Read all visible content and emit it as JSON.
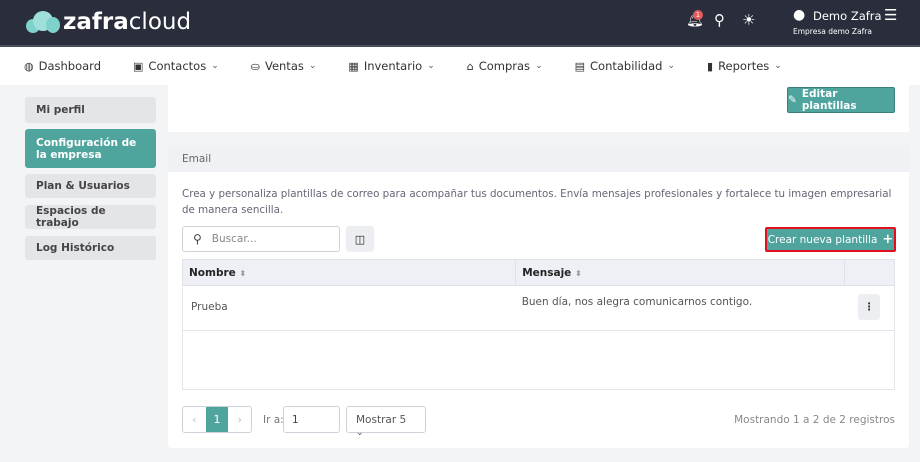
{
  "header": {
    "logo_bold": "zafra",
    "logo_light": "cloud",
    "notification_count": "1",
    "user_name": "Demo Zafra",
    "company": "Empresa demo Zafra"
  },
  "nav": [
    {
      "label": "Dashboard",
      "icon": "dashboard-icon",
      "glyph": "◍"
    },
    {
      "label": "Contactos",
      "icon": "contacts-icon",
      "glyph": "▣"
    },
    {
      "label": "Ventas",
      "icon": "sales-icon",
      "glyph": "⛀"
    },
    {
      "label": "Inventario",
      "icon": "inventory-icon",
      "glyph": "▦"
    },
    {
      "label": "Compras",
      "icon": "store-icon",
      "glyph": "⌂"
    },
    {
      "label": "Contabilidad",
      "icon": "calculator-icon",
      "glyph": "▤"
    },
    {
      "label": "Reportes",
      "icon": "chart-icon",
      "glyph": "▮"
    }
  ],
  "sidebar": [
    {
      "label": "Mi perfil"
    },
    {
      "label": "Configuración de la empresa"
    },
    {
      "label": "Plan & Usuarios"
    },
    {
      "label": "Espacios de trabajo"
    },
    {
      "label": "Log Histórico"
    }
  ],
  "main": {
    "edit_templates": "Editar plantillas",
    "section_title": "Email",
    "description": "Crea y personaliza plantillas de correo para acompañar tus documentos. Envía mensajes profesionales y fortalece tu imagen empresarial de manera sencilla.",
    "search_placeholder": "Buscar...",
    "create_button": "Crear nueva plantilla",
    "columns": [
      "Nombre",
      "Mensaje",
      ""
    ],
    "rows": [
      {
        "nombre": "Prueba",
        "mensaje": "Buen día, nos alegra comunicarnos contigo."
      }
    ],
    "pagination": {
      "current_page": "1",
      "goto_label": "Ir a:",
      "goto_value": "1",
      "page_size": "Mostrar 5",
      "summary": "Mostrando 1 a 2 de 2 registros"
    }
  },
  "colors": {
    "accent": "#4fa59e",
    "header_bg": "#2a2d3c",
    "highlight": "#e0101e"
  }
}
